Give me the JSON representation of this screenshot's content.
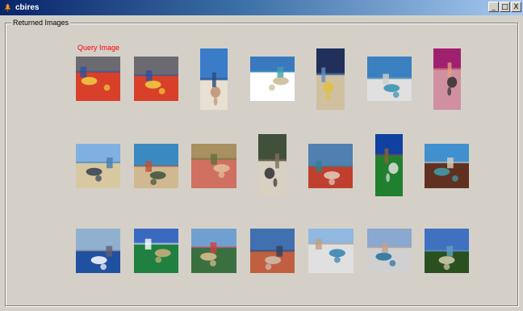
{
  "window": {
    "title": "cbires",
    "buttons": {
      "minimize": "_",
      "maximize": "□",
      "close": "X"
    }
  },
  "panel": {
    "label": "Returned Images",
    "query_label": "Query Image"
  },
  "images": [
    {
      "icon": "market-stall-image",
      "colors": [
        "#6a6a70",
        "#d8402a",
        "#f0d040",
        "#3050a0"
      ]
    },
    {
      "icon": "market-stall-image",
      "colors": [
        "#6a6a70",
        "#d8402a",
        "#f0d040",
        "#3050a0"
      ]
    },
    {
      "icon": "beach-person-image",
      "colors": [
        "#3a7cc8",
        "#e8e0d0",
        "#c09070",
        "#2a4a80"
      ]
    },
    {
      "icon": "beach-clouds-image",
      "colors": [
        "#3a78c0",
        "#ffffff",
        "#c8b890",
        "#40a0b0"
      ]
    },
    {
      "icon": "beach-umbrella-image",
      "colors": [
        "#20305a",
        "#d0c0a0",
        "#e0c040",
        "#6090c0"
      ]
    },
    {
      "icon": "beach-crowd-image",
      "colors": [
        "#3a80c0",
        "#e0e0e0",
        "#3090b0",
        "#d0d0c8"
      ]
    },
    {
      "icon": "sunbather-image",
      "colors": [
        "#a02070",
        "#d090a0",
        "#303030",
        "#e0a080"
      ]
    },
    {
      "icon": "beach-city-image",
      "colors": [
        "#80b0e0",
        "#d8c8a0",
        "#304050",
        "#4080b0"
      ]
    },
    {
      "icon": "beach-huts-image",
      "colors": [
        "#3a8ac0",
        "#d0b890",
        "#405040",
        "#c05030"
      ]
    },
    {
      "icon": "woman-on-sand-image",
      "colors": [
        "#a89060",
        "#d07060",
        "#e0c0a0",
        "#607040"
      ]
    },
    {
      "icon": "rocky-coast-image",
      "colors": [
        "#40503a",
        "#d8d0c0",
        "#303030",
        "#807060"
      ]
    },
    {
      "icon": "coastal-town-image",
      "colors": [
        "#5080b0",
        "#c04030",
        "#e0d0c0",
        "#308090"
      ]
    },
    {
      "icon": "palm-tree-image",
      "colors": [
        "#1040a0",
        "#208030",
        "#e0e0e0",
        "#8a6030"
      ]
    },
    {
      "icon": "rock-sea-image",
      "colors": [
        "#4090d0",
        "#603020",
        "#40a0b0",
        "#d8d0c0"
      ]
    },
    {
      "icon": "waves-image",
      "colors": [
        "#90b0d0",
        "#2050a0",
        "#ffffff",
        "#606070"
      ]
    },
    {
      "icon": "plants-beach-image",
      "colors": [
        "#3a6ac0",
        "#208040",
        "#d0b080",
        "#ffffff"
      ]
    },
    {
      "icon": "beach-kite-image",
      "colors": [
        "#70a0d0",
        "#3a7040",
        "#e0c090",
        "#d04040"
      ]
    },
    {
      "icon": "crowded-bay-image",
      "colors": [
        "#4070b0",
        "#c06040",
        "#d0c0b0",
        "#304060"
      ]
    },
    {
      "icon": "city-beach-image",
      "colors": [
        "#90b8e0",
        "#e0e0e0",
        "#3080b0",
        "#c0a080"
      ]
    },
    {
      "icon": "bay-hotels-image",
      "colors": [
        "#8aa8d0",
        "#d0d0d0",
        "#2070a0",
        "#c0a090"
      ]
    },
    {
      "icon": "headland-beach-image",
      "colors": [
        "#4070c0",
        "#2a5020",
        "#d8d0b0",
        "#60a0c0"
      ]
    }
  ]
}
